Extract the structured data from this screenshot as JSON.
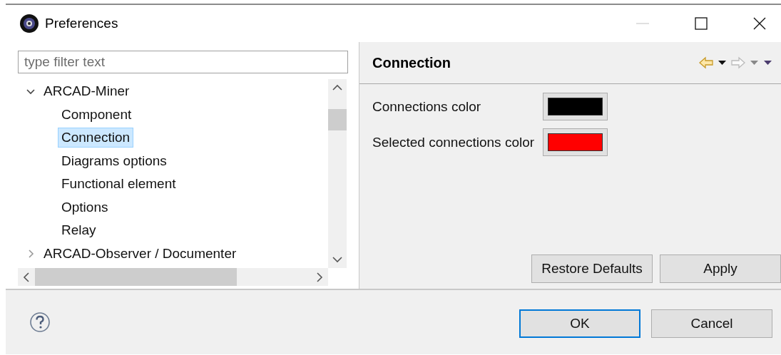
{
  "window": {
    "title": "Preferences"
  },
  "filter": {
    "placeholder": "type filter text"
  },
  "tree": [
    {
      "label": "ARCAD-Miner",
      "expanded": true,
      "selected": false,
      "children": [
        {
          "label": "Component",
          "selected": false
        },
        {
          "label": "Connection",
          "selected": true
        },
        {
          "label": "Diagrams options",
          "selected": false
        },
        {
          "label": "Functional element",
          "selected": false
        },
        {
          "label": "Options",
          "selected": false
        },
        {
          "label": "Relay",
          "selected": false
        }
      ]
    },
    {
      "label": "ARCAD-Observer / Documenter",
      "expanded": false,
      "selected": false
    }
  ],
  "page": {
    "title": "Connection",
    "settings": [
      {
        "label": "Connections color",
        "color": "#000000"
      },
      {
        "label": "Selected connections color",
        "color": "#ff0000"
      }
    ],
    "buttons": [
      "Restore Defaults",
      "Apply"
    ]
  },
  "footer": {
    "buttons": [
      {
        "label": "OK",
        "default": true
      },
      {
        "label": "Cancel",
        "default": false
      }
    ]
  }
}
